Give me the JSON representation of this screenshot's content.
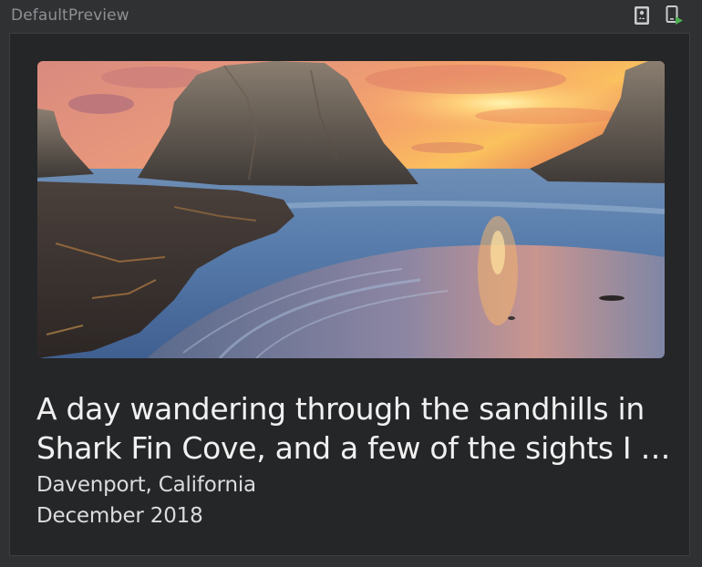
{
  "window": {
    "title": "DefaultPreview"
  },
  "toolbar": {
    "icons": [
      "deploy-to-device-icon",
      "run-preview-icon"
    ]
  },
  "card": {
    "image_alt": "Shark Fin Cove seascape at sunset",
    "headline": "A day wandering through the sandhills in Shark Fin Cove, and a few of the sights I …",
    "location": "Davenport, California",
    "date": "December 2018"
  },
  "colors": {
    "background": "#2f3133",
    "preview_surface": "#252628",
    "title_text": "#8e9194",
    "headline_text": "#f1f1f1",
    "run_icon_green": "#4caf50"
  }
}
